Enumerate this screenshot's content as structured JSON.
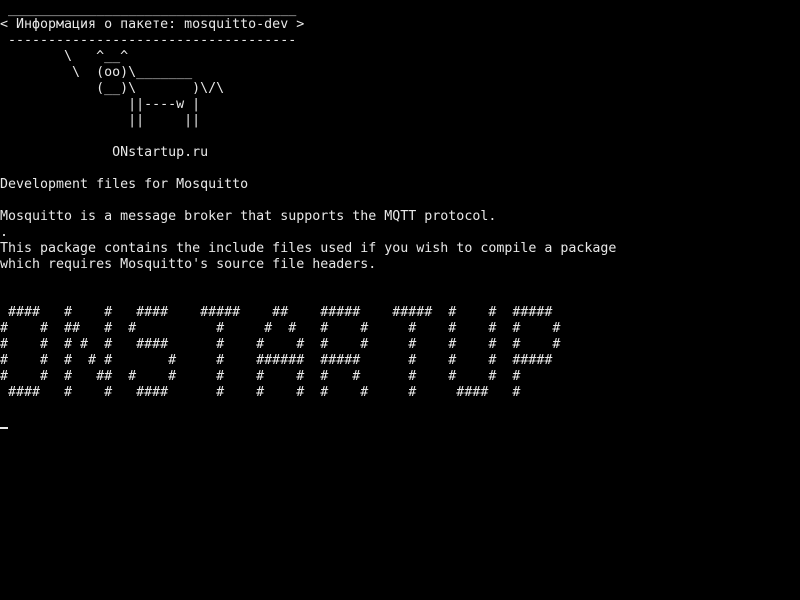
{
  "terminal": {
    "speech_bubble": {
      "top_border": " ____________________________________",
      "text": "< Информация о пакете: mosquitto-dev >",
      "bottom_border": " ------------------------------------"
    },
    "cow": [
      "        \\   ^__^",
      "         \\  (oo)\\_______",
      "            (__)\\       )\\/\\",
      "                ||----w |",
      "                ||     ||"
    ],
    "site": "              ONstartup.ru",
    "summary": "Development files for Mosquitto",
    "description": [
      "Mosquitto is a message broker that supports the MQTT protocol.",
      ".",
      "This package contains the include files used if you wish to compile a package",
      "which requires Mosquitto's source file headers."
    ],
    "banner": [
      " ####   #    #   ####    #####    ##    #####    #####  #    #  #####",
      "#    #  ##   #  #          #     #  #   #    #     #    #    #  #    #",
      "#    #  # #  #   ####      #    #    #  #    #     #    #    #  #    #",
      "#    #  #  # #       #     #    ######  #####      #    #    #  #####",
      "#    #  #   ##  #    #     #    #    #  #   #      #    #    #  #",
      " ####   #    #   ####      #    #    #  #    #     #     ####   #"
    ],
    "colors": {
      "background": "#000000",
      "foreground": "#e8e8e8"
    }
  }
}
